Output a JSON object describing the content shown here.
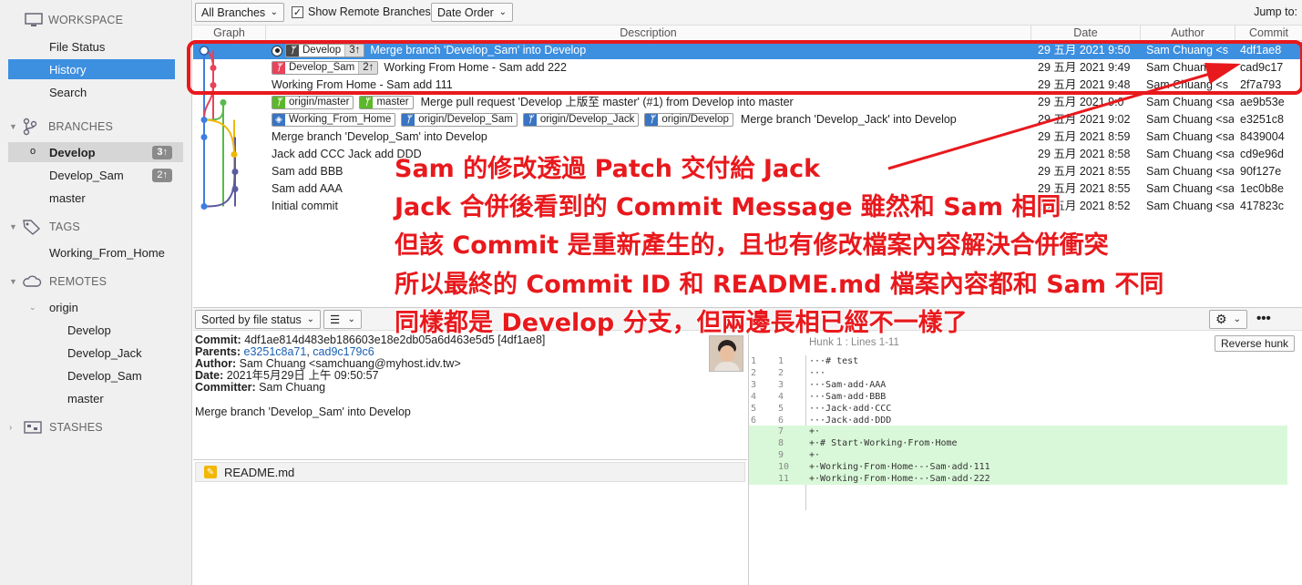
{
  "sidebar": {
    "workspace_label": "WORKSPACE",
    "workspace_items": [
      "File Status",
      "History",
      "Search"
    ],
    "branches_label": "BRANCHES",
    "branches": [
      {
        "name": "Develop",
        "badge": "3↑"
      },
      {
        "name": "Develop_Sam",
        "badge": "2↑"
      },
      {
        "name": "master",
        "badge": ""
      }
    ],
    "tags_label": "TAGS",
    "tags": [
      "Working_From_Home"
    ],
    "remotes_label": "REMOTES",
    "remote_name": "origin",
    "remote_branches": [
      "Develop",
      "Develop_Jack",
      "Develop_Sam",
      "master"
    ],
    "stashes_label": "STASHES"
  },
  "toolbar": {
    "branches_filter": "All Branches",
    "show_remote_label": "Show Remote Branches",
    "show_remote_checked": true,
    "order": "Date Order",
    "jump_to": "Jump to:"
  },
  "columns": {
    "graph": "Graph",
    "description": "Description",
    "date": "Date",
    "author": "Author",
    "commit": "Commit"
  },
  "commits": [
    {
      "tags": [
        {
          "label": "Develop",
          "count": "3↑",
          "kind": "current"
        }
      ],
      "message": "Merge branch 'Develop_Sam' into Develop",
      "date": "29 五月 2021 9:50",
      "author": "Sam Chuang <s",
      "hash": "4df1ae8"
    },
    {
      "tags": [
        {
          "label": "Develop_Sam",
          "count": "2↑",
          "kind": "branch-red"
        }
      ],
      "message": "Working From Home - Sam add 222",
      "date": "29 五月 2021 9:49",
      "author": "Sam Chuang <s",
      "hash": "cad9c17"
    },
    {
      "tags": [],
      "message": "Working From Home - Sam add 111",
      "date": "29 五月 2021 9:48",
      "author": "Sam Chuang <s",
      "hash": "2f7a793"
    },
    {
      "tags": [
        {
          "label": "origin/master",
          "count": "",
          "kind": "remote-green"
        },
        {
          "label": "master",
          "count": "",
          "kind": "branch-green"
        }
      ],
      "message": "Merge pull request 'Develop 上版至 master' (#1) from Develop into master",
      "date": "29 五月 2021 9:0",
      "author": "Sam Chuang <sa",
      "hash": "ae9b53e"
    },
    {
      "tags": [
        {
          "label": "Working_From_Home",
          "count": "",
          "kind": "tag"
        },
        {
          "label": "origin/Develop_Sam",
          "count": "",
          "kind": "remote"
        },
        {
          "label": "origin/Develop_Jack",
          "count": "",
          "kind": "remote"
        },
        {
          "label": "origin/Develop",
          "count": "",
          "kind": "remote"
        }
      ],
      "message": "Merge branch 'Develop_Jack' into Develop",
      "date": "29 五月 2021 9:02",
      "author": "Sam Chuang <sa",
      "hash": "e3251c8"
    },
    {
      "tags": [],
      "message": "Merge branch 'Develop_Sam' into Develop",
      "date": "29 五月 2021 8:59",
      "author": "Sam Chuang <sa",
      "hash": "8439004"
    },
    {
      "tags": [],
      "message": "Jack add CCC Jack add DDD",
      "date": "29 五月 2021 8:58",
      "author": "Sam Chuang <sa",
      "hash": "cd9e96d"
    },
    {
      "tags": [],
      "message": "Sam add BBB",
      "date": "29 五月 2021 8:55",
      "author": "Sam Chuang <sa",
      "hash": "90f127e"
    },
    {
      "tags": [],
      "message": "Sam add AAA",
      "date": "29 五月 2021 8:55",
      "author": "Sam Chuang <sa",
      "hash": "1ec0b8e"
    },
    {
      "tags": [],
      "message": "Initial commit",
      "date": "29 五月 2021 8:52",
      "author": "Sam Chuang <sa",
      "hash": "417823c"
    }
  ],
  "detail": {
    "sort": "Sorted by file status",
    "commit_label": "Commit:",
    "commit_value": "4df1ae814d483eb186603e18e2db05a6d463e5d5 [4df1ae8]",
    "parents_label": "Parents:",
    "parent1": "e3251c8a71",
    "parent_sep": ", ",
    "parent2": "cad9c179c6",
    "author_label": "Author:",
    "author_value": "Sam Chuang <samchuang@myhost.idv.tw>",
    "date_label": "Date:",
    "date_value": "2021年5月29日 上午 09:50:57",
    "committer_label": "Committer:",
    "committer_value": "Sam Chuang",
    "message": "Merge branch 'Develop_Sam' into Develop",
    "file": "README.md"
  },
  "diff": {
    "hunk": "Hunk 1 : Lines 1-11",
    "reverse": "Reverse hunk",
    "lines": [
      {
        "o": "1",
        "n": "1",
        "t": "···# test",
        "add": false
      },
      {
        "o": "2",
        "n": "2",
        "t": "···",
        "add": false
      },
      {
        "o": "3",
        "n": "3",
        "t": "···Sam·add·AAA",
        "add": false
      },
      {
        "o": "4",
        "n": "4",
        "t": "···Sam·add·BBB",
        "add": false
      },
      {
        "o": "5",
        "n": "5",
        "t": "···Jack·add·CCC",
        "add": false
      },
      {
        "o": "6",
        "n": "6",
        "t": "···Jack·add·DDD",
        "add": false
      },
      {
        "o": "",
        "n": "7",
        "t": "+·",
        "add": true
      },
      {
        "o": "",
        "n": "8",
        "t": "+·# Start·Working·From·Home",
        "add": true
      },
      {
        "o": "",
        "n": "9",
        "t": "+·",
        "add": true
      },
      {
        "o": "",
        "n": "10",
        "t": "+·Working·From·Home·-·Sam·add·111",
        "add": true
      },
      {
        "o": "",
        "n": "11",
        "t": "+·Working·From·Home·-·Sam·add·222",
        "add": true
      }
    ]
  },
  "annotation": [
    "Sam 的修改透過 Patch 交付給 Jack",
    "Jack 合併後看到的 Commit Message 雖然和 Sam 相同",
    "但該 Commit 是重新產生的，且也有修改檔案內容解決合併衝突",
    "所以最終的 Commit ID 和 README.md 檔案內容都和 Sam 不同",
    "同樣都是 Develop 分支，但兩邊長相已經不一樣了"
  ],
  "colors": {
    "selection": "#3d8fe0",
    "annotation": "#e8191d",
    "added_line": "#d9f8d9",
    "link": "#1a5fb4"
  }
}
